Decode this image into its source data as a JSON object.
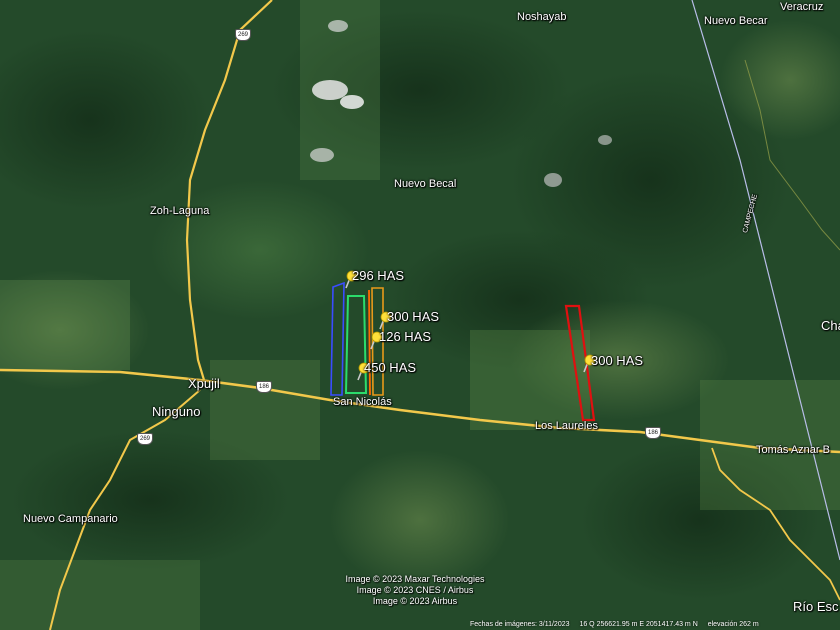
{
  "places": {
    "noshayab": "Noshayab",
    "nuevo_becar": "Nuevo Becar",
    "veracruz": "Veracruz",
    "nuevo_becal": "Nuevo Becal",
    "zoh_laguna": "Zoh-Laguna",
    "xpujil": "Xpujil",
    "ninguno": "Ninguno",
    "san_nicolas": "San Nicolás",
    "los_laureles": "Los Laureles",
    "tomas_aznar": "Tomás Aznar B",
    "nuevo_campanario": "Nuevo Campanario",
    "rio_esc": "Río Esc",
    "cha": "Cha",
    "campeche": "CAMPECHE"
  },
  "route_shields": {
    "r269_north": "269",
    "r186_xpujil": "186",
    "r269_south": "269",
    "r186_east": "186"
  },
  "parcels": [
    {
      "label": "296 HAS",
      "color": "#3a4cff"
    },
    {
      "label": "300 HAS",
      "color": "#e89a1a"
    },
    {
      "label": "126 HAS",
      "color": "#ff6a00"
    },
    {
      "label": "450 HAS",
      "color": "#2bdc6b"
    },
    {
      "label": "300 HAS",
      "color": "#e01010"
    }
  ],
  "credits": [
    "Image © 2023 Maxar Technologies",
    "Image © 2023 CNES / Airbus",
    "Image © 2023 Airbus"
  ],
  "statusbar": {
    "date": "Fechas de imágenes: 3/11/2023",
    "coords": "16 Q 256621.95 m E 2051417.43 m N",
    "elevation": "elevación 262 m"
  }
}
